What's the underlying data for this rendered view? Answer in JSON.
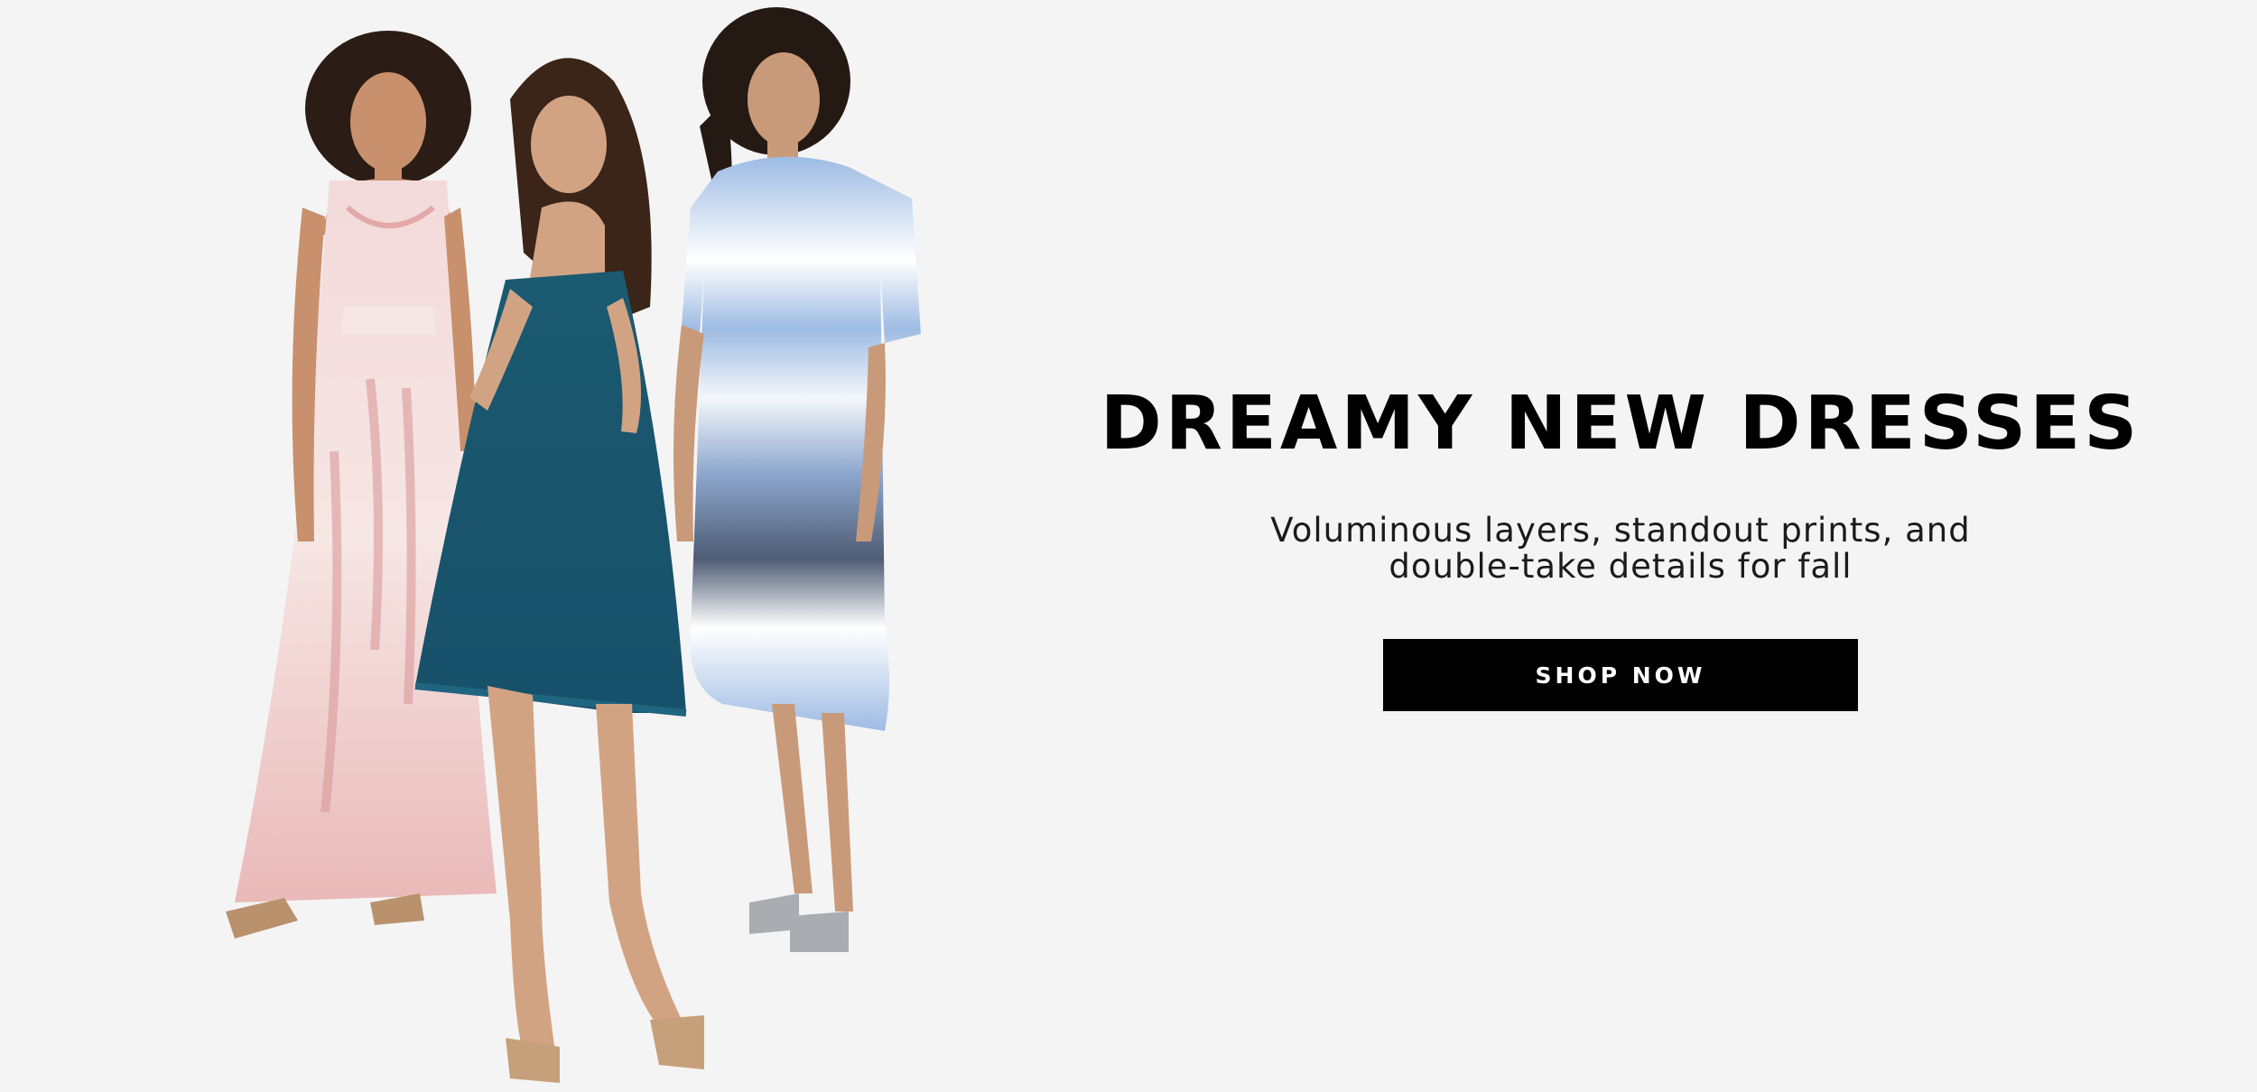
{
  "hero": {
    "headline": "DREAMY NEW DRESSES",
    "subcopy_line1": "Voluminous layers, standout prints, and",
    "subcopy_line2": "double-take details for fall",
    "cta_label": "SHOP NOW"
  },
  "colors": {
    "background": "#f4f4f4",
    "cta_background": "#000000",
    "cta_text": "#ffffff",
    "headline": "#000000"
  }
}
